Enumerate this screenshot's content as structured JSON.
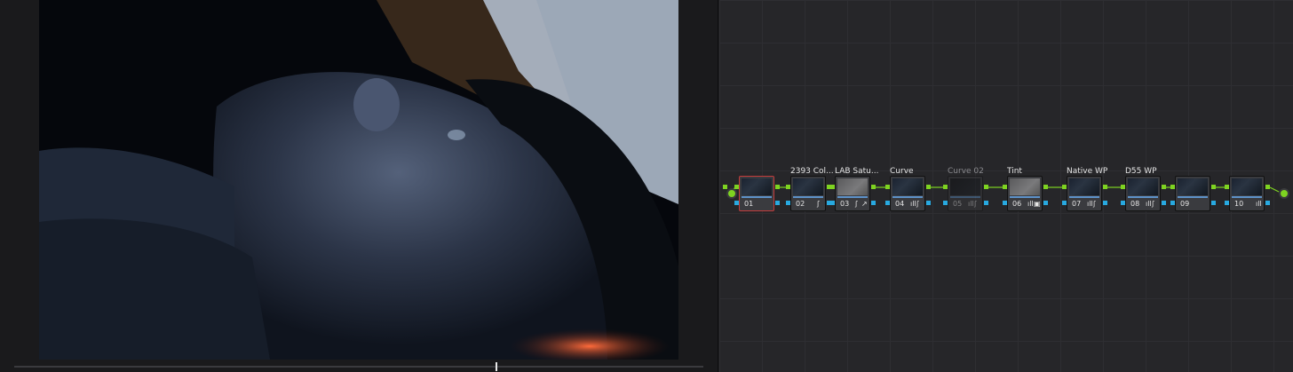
{
  "viewer": {
    "image": "portrait-frame",
    "playhead_position_fraction": 0.698
  },
  "nodes": [
    {
      "number": "01",
      "label": "",
      "icons": [],
      "selected": true,
      "disabled": false,
      "thumb": "normal"
    },
    {
      "number": "02",
      "label": "2393 Col...",
      "icons": [
        "curve-icon"
      ],
      "selected": false,
      "disabled": false,
      "thumb": "normal"
    },
    {
      "number": "03",
      "label": "LAB Satu...",
      "icons": [
        "curve-icon",
        "picker-icon"
      ],
      "selected": false,
      "disabled": false,
      "thumb": "grey"
    },
    {
      "number": "04",
      "label": "Curve",
      "icons": [
        "levels-icon",
        "curve-icon"
      ],
      "selected": false,
      "disabled": false,
      "thumb": "normal"
    },
    {
      "number": "05",
      "label": "Curve 02",
      "icons": [
        "levels-icon",
        "curve-icon"
      ],
      "selected": false,
      "disabled": true,
      "thumb": "dark"
    },
    {
      "number": "06",
      "label": "Tint",
      "icons": [
        "levels-icon",
        "qualifier-icon"
      ],
      "selected": false,
      "disabled": false,
      "thumb": "grey"
    },
    {
      "number": "07",
      "label": "Native WP",
      "icons": [
        "levels-icon",
        "curve-icon"
      ],
      "selected": false,
      "disabled": false,
      "thumb": "normal"
    },
    {
      "number": "08",
      "label": "D55 WP",
      "icons": [
        "levels-icon",
        "curve-icon"
      ],
      "selected": false,
      "disabled": false,
      "thumb": "normal"
    },
    {
      "number": "09",
      "label": "",
      "icons": [],
      "selected": false,
      "disabled": false,
      "thumb": "normal"
    },
    {
      "number": "10",
      "label": "",
      "icons": [
        "levels-icon"
      ],
      "selected": false,
      "disabled": false,
      "thumb": "normal"
    }
  ],
  "icon_glyphs": {
    "curve-icon": "ʃ",
    "picker-icon": "↗",
    "levels-icon": "ıll",
    "qualifier-icon": "▣"
  },
  "colors": {
    "rgb_link": "#7ed321",
    "alpha_link": "#28a9e0",
    "selected_border": "#c23b3b"
  }
}
